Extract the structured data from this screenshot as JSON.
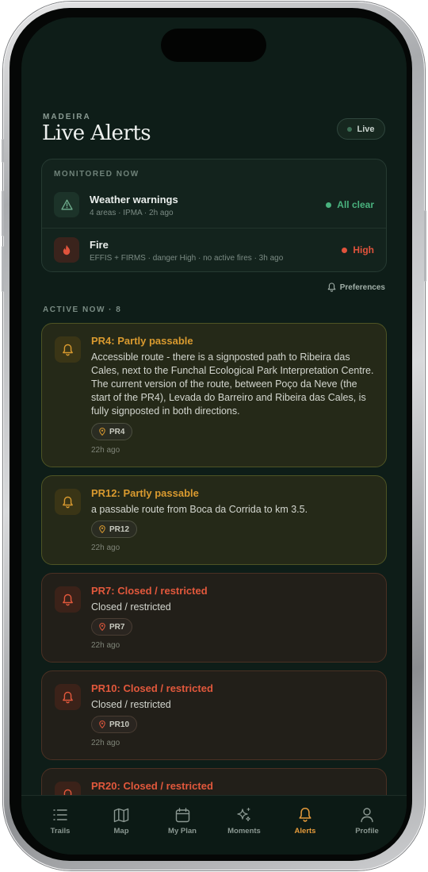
{
  "header": {
    "overline": "MADEIRA",
    "title": "Live Alerts",
    "live_label": "Live"
  },
  "monitor": {
    "label": "MONITORED NOW",
    "items": [
      {
        "title": "Weather warnings",
        "meta": "4 areas · IPMA · 2h ago",
        "status": "All clear",
        "icon": "warning-triangle-icon"
      },
      {
        "title": "Fire",
        "meta": "EFFIS + FIRMS · danger High · no active fires · 3h ago",
        "status": "High",
        "icon": "flame-icon"
      }
    ]
  },
  "preferences_label": "Preferences",
  "active_label": "ACTIVE NOW · 8",
  "alerts": [
    {
      "title": "PR4: Partly passable",
      "body": "Accessible route - there is a signposted path to Ribeira das Cales, next to the Funchal Ecological Park Interpretation Centre. The current version of the route, between Poço da Neve (the start of the PR4), Levada do Barreiro and Ribeira das Cales, is fully signposted in both directions.",
      "trail": "PR4",
      "time": "22h ago",
      "severity": "partly"
    },
    {
      "title": "PR12: Partly passable",
      "body": "a passable route from Boca da Corrida to km 3.5.",
      "trail": "PR12",
      "time": "22h ago",
      "severity": "partly"
    },
    {
      "title": "PR7: Closed / restricted",
      "body": "Closed / restricted",
      "trail": "PR7",
      "time": "22h ago",
      "severity": "closed"
    },
    {
      "title": "PR10: Closed / restricted",
      "body": "Closed / restricted",
      "trail": "PR10",
      "time": "22h ago",
      "severity": "closed"
    },
    {
      "title": "PR20: Closed / restricted",
      "severity": "closed"
    }
  ],
  "tabs": [
    {
      "label": "Trails",
      "icon": "list-icon"
    },
    {
      "label": "Map",
      "icon": "map-icon"
    },
    {
      "label": "My Plan",
      "icon": "calendar-icon"
    },
    {
      "label": "Moments",
      "icon": "sparkles-icon"
    },
    {
      "label": "Alerts",
      "icon": "bell-icon",
      "active": true
    },
    {
      "label": "Profile",
      "icon": "user-icon"
    }
  ],
  "colors": {
    "background": "#0e1d18",
    "accent": "#e49a3b",
    "clear": "#49b27e",
    "danger": "#e0533c",
    "partly": "#d99a2f"
  }
}
